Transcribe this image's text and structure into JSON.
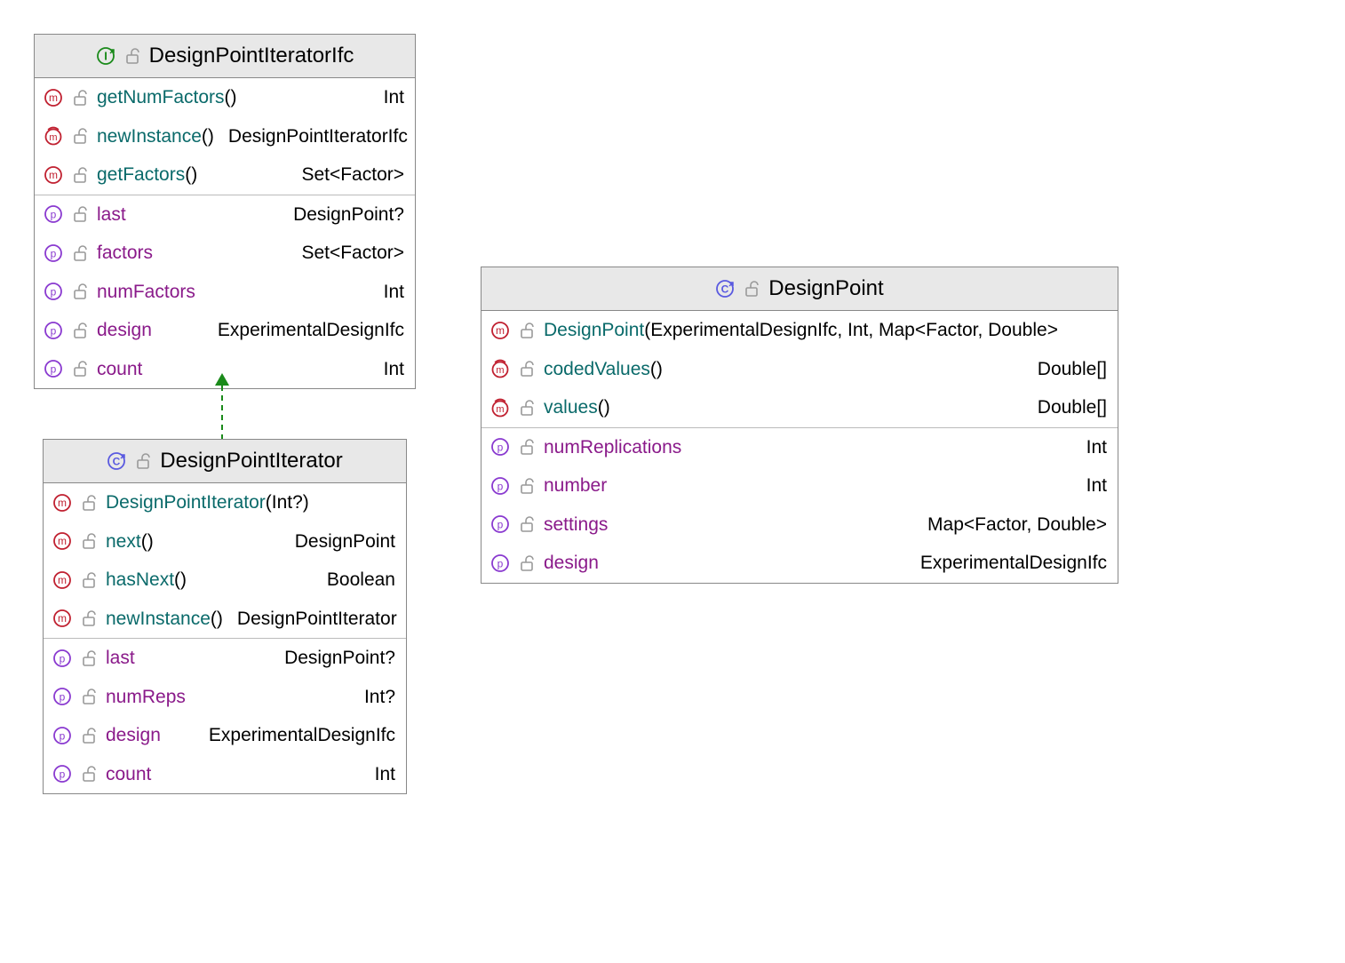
{
  "classes": {
    "ifc": {
      "title": "DesignPointIteratorIfc",
      "headerKind": "interface",
      "methods": [
        {
          "kind": "m",
          "name": "getNumFactors",
          "params": "()",
          "ret": "Int",
          "overridden": false
        },
        {
          "kind": "m",
          "name": "newInstance",
          "params": "()",
          "ret": "DesignPointIteratorIfc",
          "overridden": true
        },
        {
          "kind": "m",
          "name": "getFactors",
          "params": "()",
          "ret": "Set<Factor>",
          "overridden": false
        }
      ],
      "properties": [
        {
          "name": "last",
          "type": "DesignPoint?"
        },
        {
          "name": "factors",
          "type": "Set<Factor>"
        },
        {
          "name": "numFactors",
          "type": "Int"
        },
        {
          "name": "design",
          "type": "ExperimentalDesignIfc"
        },
        {
          "name": "count",
          "type": "Int"
        }
      ]
    },
    "iter": {
      "title": "DesignPointIterator",
      "headerKind": "class",
      "methods": [
        {
          "kind": "m",
          "name": "DesignPointIterator",
          "params": "(Int?)",
          "ret": "",
          "overridden": false
        },
        {
          "kind": "m",
          "name": "next",
          "params": "()",
          "ret": "DesignPoint",
          "overridden": false
        },
        {
          "kind": "m",
          "name": "hasNext",
          "params": "()",
          "ret": "Boolean",
          "overridden": false
        },
        {
          "kind": "m",
          "name": "newInstance",
          "params": "()",
          "ret": "DesignPointIterator",
          "overridden": false
        }
      ],
      "properties": [
        {
          "name": "last",
          "type": "DesignPoint?"
        },
        {
          "name": "numReps",
          "type": "Int?"
        },
        {
          "name": "design",
          "type": "ExperimentalDesignIfc"
        },
        {
          "name": "count",
          "type": "Int"
        }
      ]
    },
    "dp": {
      "title": "DesignPoint",
      "headerKind": "class",
      "methods": [
        {
          "kind": "m",
          "name": "DesignPoint",
          "params": "(ExperimentalDesignIfc, Int, Map<Factor, Double>",
          "ret": "",
          "overridden": false
        },
        {
          "kind": "m",
          "name": "codedValues",
          "params": "()",
          "ret": "Double[]",
          "overridden": true
        },
        {
          "kind": "m",
          "name": "values",
          "params": "()",
          "ret": "Double[]",
          "overridden": true
        }
      ],
      "properties": [
        {
          "name": "numReplications",
          "type": "Int"
        },
        {
          "name": "number",
          "type": "Int"
        },
        {
          "name": "settings",
          "type": "Map<Factor, Double>"
        },
        {
          "name": "design",
          "type": "ExperimentalDesignIfc"
        }
      ]
    }
  }
}
